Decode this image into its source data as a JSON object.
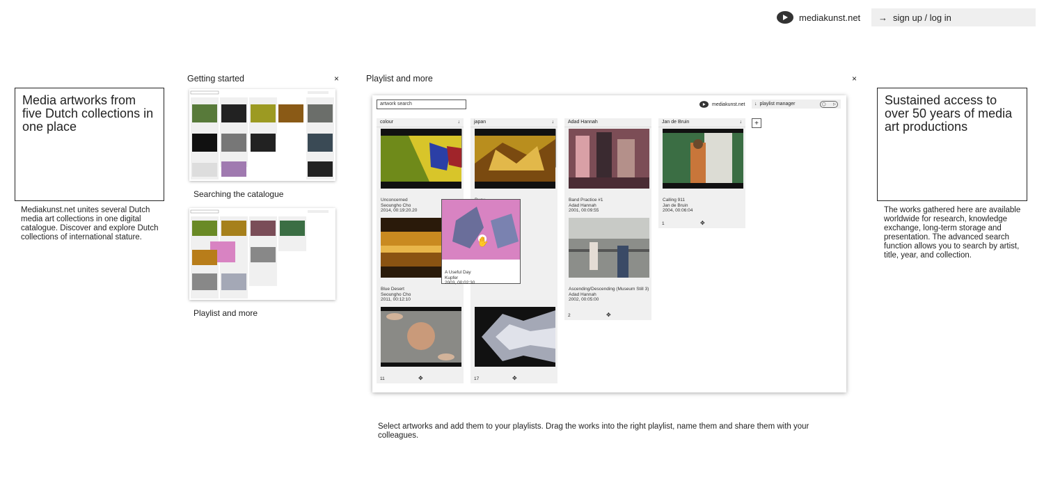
{
  "header": {
    "brand": "mediakunst.net",
    "login": "sign up / log in"
  },
  "left": {
    "tagline": "Media artworks from five Dutch collections in one place",
    "description": "Mediakunst.net unites several Dutch media art collections in one digital catalogue. Discover and explore Dutch collections of international stature."
  },
  "right": {
    "tagline": "Sustained access to over 50 years of media art productions",
    "description": "The works gathered here are available worldwide for research, knowledge exchange, long-term storage and presentation. The advanced search function allows you to search by artist, title, year, and collection."
  },
  "sidebar": {
    "title": "Getting started",
    "close": "×",
    "items": [
      {
        "label": "Searching the catalogue"
      },
      {
        "label": "Playlist and more"
      }
    ]
  },
  "main": {
    "title": "Playlist and more",
    "close": "×",
    "caption": "Select artworks and add them to your playlists. Drag the works into the right playlist, name them and share them with your colleagues."
  },
  "window": {
    "search_placeholder": "artwork search",
    "brand": "mediakunst.net",
    "playlist_manager": "playlist manager",
    "add": "+",
    "columns": [
      {
        "name": "colour",
        "count": "11",
        "artworks": [
          {
            "title": "Unconcerned",
            "artist": "Seoungho Cho",
            "meta": "2014, 00:19:20.20",
            "color": "#5a7a22"
          },
          {
            "title": "Blue Desert",
            "artist": "Seoungho Cho",
            "meta": "2011, 00:12:10",
            "color": "#b87d1a"
          },
          {
            "title": "",
            "artist": "",
            "meta": "",
            "color": "#8a8a86"
          }
        ]
      },
      {
        "name": "japan",
        "count": "17",
        "artworks": [
          {
            "title": "Buoy",
            "artist": "",
            "meta": "",
            "color": "#b98e1e"
          },
          {
            "title": "",
            "artist": "",
            "meta": "",
            "color": "#a4a8b6"
          }
        ]
      },
      {
        "name": "Adad Hannah",
        "count": "2",
        "artworks": [
          {
            "title": "Band Practice #1",
            "artist": "Adad Hannah",
            "meta": "2001, 00:09:55",
            "color": "#7c4d56"
          },
          {
            "title": "Ascending/Descending (Museum Still 3)",
            "artist": "Adad Hannah",
            "meta": "2002, 00:05:00",
            "color": "#8c8e8a"
          }
        ]
      },
      {
        "name": "Jan de Bruin",
        "count": "1",
        "artworks": [
          {
            "title": "Calling 911",
            "artist": "Jan de Bruin",
            "meta": "2004, 00:06:04",
            "color": "#3b6e44"
          }
        ]
      }
    ],
    "dragged": {
      "title": "A Useful Day",
      "artist": "Kupfer",
      "meta": "2003, 00:02:30",
      "color": "#d883c2"
    }
  }
}
